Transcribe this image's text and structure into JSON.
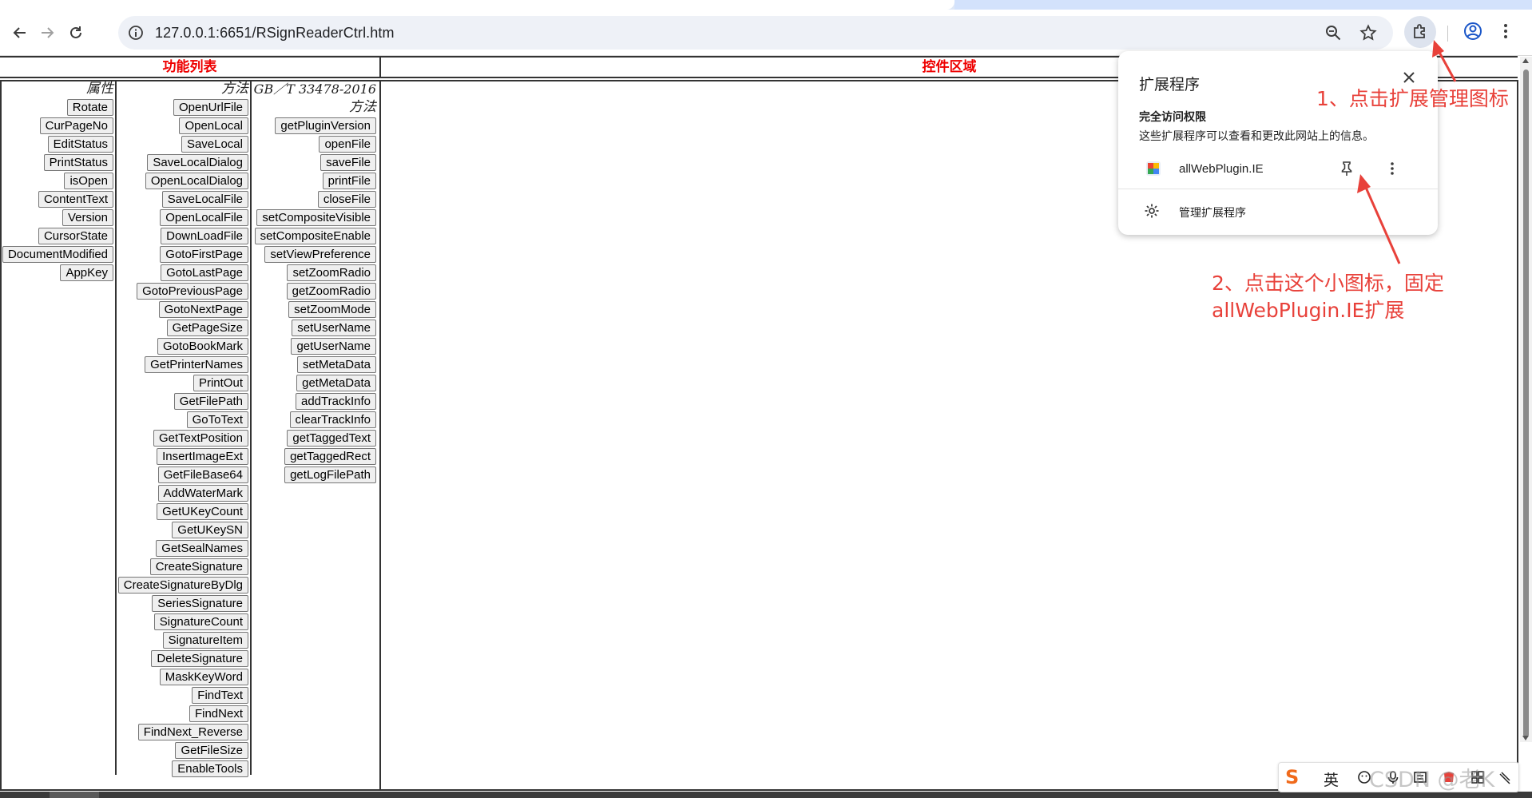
{
  "browser": {
    "url": "127.0.0.1:6651/RSignReaderCtrl.htm"
  },
  "page": {
    "left_header": "功能列表",
    "right_header": "控件区域",
    "properties": {
      "title": "属性",
      "items": [
        "Rotate",
        "CurPageNo",
        "EditStatus",
        "PrintStatus",
        "isOpen",
        "ContentText",
        "Version",
        "CursorState",
        "DocumentModified",
        "AppKey"
      ]
    },
    "methods": {
      "title": "方法",
      "items": [
        "OpenUrlFile",
        "OpenLocal",
        "SaveLocal",
        "SaveLocalDialog",
        "OpenLocalDialog",
        "SaveLocalFile",
        "OpenLocalFile",
        "DownLoadFile",
        "GotoFirstPage",
        "GotoLastPage",
        "GotoPreviousPage",
        "GotoNextPage",
        "GetPageSize",
        "GotoBookMark",
        "GetPrinterNames",
        "PrintOut",
        "GetFilePath",
        "GoToText",
        "GetTextPosition",
        "InsertImageExt",
        "GetFileBase64",
        "AddWaterMark",
        "GetUKeyCount",
        "GetUKeySN",
        "GetSealNames",
        "CreateSignature",
        "CreateSignatureByDlg",
        "SeriesSignature",
        "SignatureCount",
        "SignatureItem",
        "DeleteSignature",
        "MaskKeyWord",
        "FindText",
        "FindNext",
        "FindNext_Reverse",
        "GetFileSize",
        "EnableTools"
      ]
    },
    "gb_methods": {
      "title_line1": "GB／T 33478-2016",
      "title_line2": "方法",
      "items": [
        "getPluginVersion",
        "openFile",
        "saveFile",
        "printFile",
        "closeFile",
        "setCompositeVisible",
        "setCompositeEnable",
        "setViewPreference",
        "setZoomRadio",
        "getZoomRadio",
        "setZoomMode",
        "setUserName",
        "getUserName",
        "setMetaData",
        "getMetaData",
        "addTrackInfo",
        "clearTrackInfo",
        "getTaggedText",
        "getTaggedRect",
        "getLogFilePath"
      ]
    }
  },
  "popup": {
    "title": "扩展程序",
    "section_title": "完全访问权限",
    "section_desc": "这些扩展程序可以查看和更改此网站上的信息。",
    "extension_name": "allWebPlugin.IE",
    "manage_label": "管理扩展程序"
  },
  "annotations": {
    "step1": "1、点击扩展管理图标",
    "step2_line1": "2、点击这个小图标，固定",
    "step2_line2": "allWebPlugin.IE扩展"
  },
  "ime": {
    "lang": "英"
  },
  "watermark": "CSDN @老K",
  "colors": {
    "header_red": "#ee0000",
    "annotation_red": "#e8413a",
    "omnibox_bg": "#eef1f7"
  }
}
